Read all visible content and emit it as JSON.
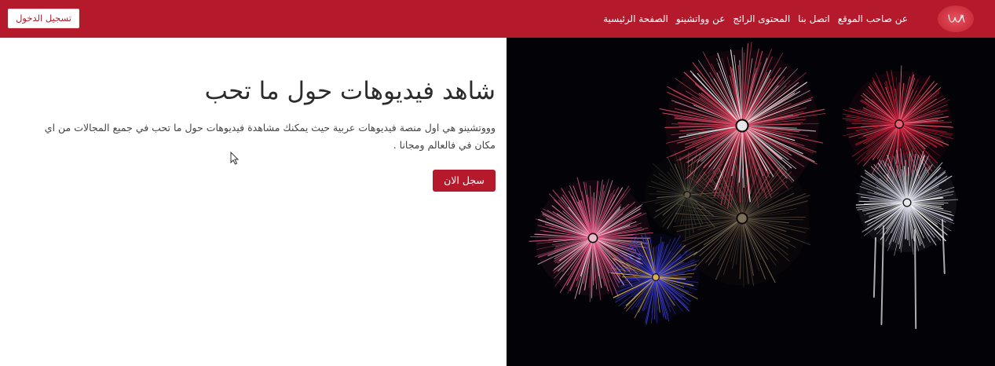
{
  "colors": {
    "brand": "#b51a2c",
    "navbar_bg": "#b51a2c",
    "button_text": "#b51a2c",
    "hero_image_bg": "#030206"
  },
  "navbar": {
    "logo_icon": "wa-script-logo",
    "links": [
      {
        "label": "الصفحة الرئيسية"
      },
      {
        "label": "عن وواتشينو"
      },
      {
        "label": "المحتوى الرائج"
      },
      {
        "label": "اتصل بنا"
      },
      {
        "label": "عن صاحب الموقع"
      }
    ],
    "login_label": "تسجيل الدخول"
  },
  "hero": {
    "title": "شاهد فيديوهات حول ما تحب",
    "description": "وووتشينو هي اول منصة فيديوهات عربية حيث يمكنك مشاهدة فيديوهات حول ما تحب في جميع المجالات من اي مكان في فالعالم ومجانا .",
    "cta_label": "سجل الان",
    "image_subject": "fireworks"
  }
}
